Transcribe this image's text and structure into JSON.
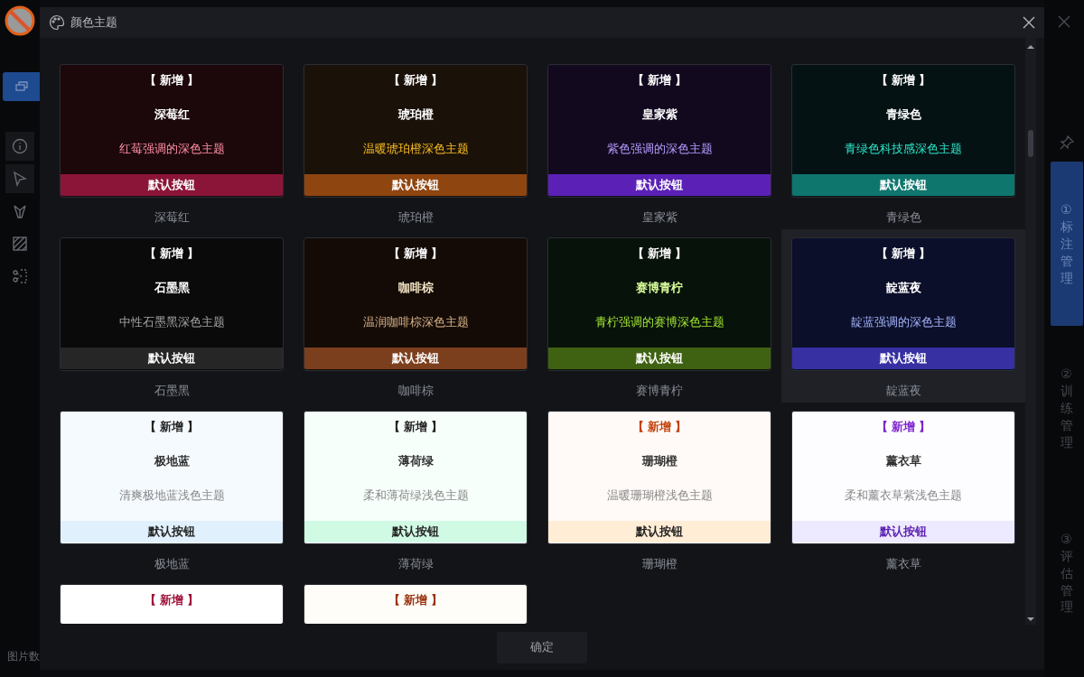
{
  "app": {
    "status_text": "图片数",
    "tabs": [
      {
        "label": "①标注管理",
        "selected": true
      },
      {
        "label": "②训练管理",
        "selected": false
      },
      {
        "label": "③评估管理",
        "selected": false
      }
    ]
  },
  "dialog": {
    "title": "颜色主题",
    "confirm": "确定",
    "themes": [
      {
        "color": "#1c070b",
        "tag": {
          "text": "【 新增 】",
          "color": "#ffffff"
        },
        "name": {
          "text": "深莓红",
          "color": "#ffffff"
        },
        "description": {
          "text": "红莓强调的深色主题",
          "color": "#ff8fa3"
        },
        "button": {
          "text": "默认按钮",
          "color": "#8b1538",
          "font": {
            "color": "#ffffff"
          }
        },
        "label": "深莓红",
        "selected": false
      },
      {
        "color": "#1a1108",
        "tag": {
          "text": "【 新增 】",
          "color": "#ffffff"
        },
        "name": {
          "text": "琥珀橙",
          "color": "#ffffff"
        },
        "description": {
          "text": "温暖琥珀橙深色主题",
          "color": "#fbbf24"
        },
        "button": {
          "text": "默认按钮",
          "color": "#8f4510",
          "font": {
            "color": "#ffffff"
          }
        },
        "label": "琥珀橙",
        "selected": false
      },
      {
        "color": "#12091f",
        "tag": {
          "text": "【 新增 】",
          "color": "#ffffff"
        },
        "name": {
          "text": "皇家紫",
          "color": "#ffffff"
        },
        "description": {
          "text": "紫色强调的深色主题",
          "color": "#b69cff"
        },
        "button": {
          "text": "默认按钮",
          "color": "#5b21b6",
          "font": {
            "color": "#ffffff"
          }
        },
        "label": "皇家紫",
        "selected": false
      },
      {
        "color": "#041214",
        "tag": {
          "text": "【 新增 】",
          "color": "#ffffff"
        },
        "name": {
          "text": "青绿色",
          "color": "#ffffff"
        },
        "description": {
          "text": "青绿色科技感深色主题",
          "color": "#2ee6c8"
        },
        "button": {
          "text": "默认按钮",
          "color": "#0f766e",
          "font": {
            "color": "#ffffff"
          }
        },
        "label": "青绿色",
        "selected": false
      },
      {
        "color": "#0a0a0a",
        "tag": {
          "text": "【 新增 】",
          "color": "#ffffff"
        },
        "name": {
          "text": "石墨黑",
          "color": "#ffffff"
        },
        "description": {
          "text": "中性石墨黑深色主题",
          "color": "#a3a3a3"
        },
        "button": {
          "text": "默认按钮",
          "color": "#262626",
          "font": {
            "color": "#ffffff"
          }
        },
        "label": "石墨黑",
        "selected": false
      },
      {
        "color": "#140b06",
        "tag": {
          "text": "【 新增 】",
          "color": "#ffffff"
        },
        "name": {
          "text": "咖啡棕",
          "color": "#f3e3c3"
        },
        "description": {
          "text": "温润咖啡棕深色主题",
          "color": "#d9b48a"
        },
        "button": {
          "text": "默认按钮",
          "color": "#7c3f1e",
          "font": {
            "color": "#ffffff"
          }
        },
        "label": "咖啡棕",
        "selected": false
      },
      {
        "color": "#07120a",
        "tag": {
          "text": "【 新增 】",
          "color": "#ffffff"
        },
        "name": {
          "text": "赛博青柠",
          "color": "#d9ff99"
        },
        "description": {
          "text": "青柠强调的赛博深色主题",
          "color": "#a3e635"
        },
        "button": {
          "text": "默认按钮",
          "color": "#3f6212",
          "font": {
            "color": "#ffffff"
          }
        },
        "label": "赛博青柠",
        "selected": false
      },
      {
        "color": "#0b0f2a",
        "tag": {
          "text": "【 新增 】",
          "color": "#ffffff"
        },
        "name": {
          "text": "靛蓝夜",
          "color": "#ffffff"
        },
        "description": {
          "text": "靛蓝强调的深色主题",
          "color": "#a5b4fc"
        },
        "button": {
          "text": "默认按钮",
          "color": "#3730a3",
          "font": {
            "color": "#ffffff"
          }
        },
        "label": "靛蓝夜",
        "selected": true
      },
      {
        "color": "#f5faff",
        "tag": {
          "text": "【 新增 】",
          "color": "#222222"
        },
        "name": {
          "text": "极地蓝",
          "color": "#333333"
        },
        "description": {
          "text": "清爽极地蓝浅色主题",
          "color": "#888888"
        },
        "button": {
          "text": "默认按钮",
          "color": "#e0f0fc",
          "font": {
            "color": "#222222"
          }
        },
        "label": "极地蓝",
        "selected": false
      },
      {
        "color": "#f7fffb",
        "tag": {
          "text": "【 新增 】",
          "color": "#222222"
        },
        "name": {
          "text": "薄荷绿",
          "color": "#333333"
        },
        "description": {
          "text": "柔和薄荷绿浅色主题",
          "color": "#888888"
        },
        "button": {
          "text": "默认按钮",
          "color": "#d1fae5",
          "font": {
            "color": "#222222"
          }
        },
        "label": "薄荷绿",
        "selected": false
      },
      {
        "color": "#fffaf7",
        "tag": {
          "text": "【 新增 】",
          "color": "#c2410c"
        },
        "name": {
          "text": "珊瑚橙",
          "color": "#333333"
        },
        "description": {
          "text": "温暖珊瑚橙浅色主题",
          "color": "#888888"
        },
        "button": {
          "text": "默认按钮",
          "color": "#ffedd5",
          "font": {
            "color": "#222222"
          }
        },
        "label": "珊瑚橙",
        "selected": false
      },
      {
        "color": "#fdfcff",
        "tag": {
          "text": "【 新增 】",
          "color": "#7e22ce"
        },
        "name": {
          "text": "薰衣草",
          "color": "#333333"
        },
        "description": {
          "text": "柔和薰衣草紫浅色主题",
          "color": "#888888"
        },
        "button": {
          "text": "默认按钮",
          "color": "#ede9fe",
          "font": {
            "color": "#5b21b6"
          }
        },
        "label": "薰衣草",
        "selected": false
      },
      {
        "color": "#ffffff",
        "tag": {
          "text": "【 新增 】",
          "color": "#9f1239"
        },
        "selected": false
      },
      {
        "color": "#fffdf7",
        "tag": {
          "text": "【 新增 】",
          "color": "#9a3412"
        },
        "selected": false
      }
    ]
  }
}
